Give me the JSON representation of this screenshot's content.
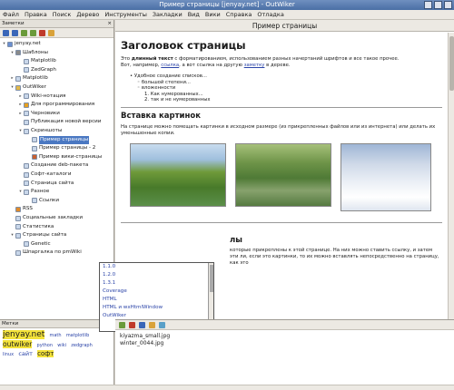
{
  "window": {
    "title": "Пример страницы [jenyay.net] - OutWiker"
  },
  "menu": [
    "Файл",
    "Правка",
    "Поиск",
    "Дерево",
    "Инструменты",
    "Закладки",
    "Вид",
    "Вики",
    "Справка",
    "Отладка"
  ],
  "left_pane": {
    "title": "Заметки",
    "tree": [
      {
        "label": "jenyay.net",
        "level": 0,
        "toggle": "▾",
        "icon": "book"
      },
      {
        "label": "Шаблоны",
        "level": 1,
        "toggle": "▾",
        "icon": "gear"
      },
      {
        "label": "Matplotlib",
        "level": 2,
        "toggle": "",
        "icon": "page"
      },
      {
        "label": "ZedGraph",
        "level": 2,
        "toggle": "",
        "icon": "page"
      },
      {
        "label": "Matplotlib",
        "level": 1,
        "toggle": "▸",
        "icon": "page"
      },
      {
        "label": "OutWiker",
        "level": 1,
        "toggle": "▾",
        "icon": "folder"
      },
      {
        "label": "Wiki-нотация",
        "level": 2,
        "toggle": "▸",
        "icon": "page"
      },
      {
        "label": "Для программирования",
        "level": 2,
        "toggle": "▸",
        "icon": "star"
      },
      {
        "label": "Черновики",
        "level": 2,
        "toggle": "▸",
        "icon": "page"
      },
      {
        "label": "Публикация новой версии",
        "level": 2,
        "toggle": "",
        "icon": "page"
      },
      {
        "label": "Скриншоты",
        "level": 2,
        "toggle": "▾",
        "icon": "page"
      },
      {
        "label": "Пример страницы",
        "level": 3,
        "toggle": "",
        "icon": "page",
        "selected": true
      },
      {
        "label": "Пример страницы - 2",
        "level": 3,
        "toggle": "",
        "icon": "page"
      },
      {
        "label": "Пример вики-страницы",
        "level": 3,
        "toggle": "",
        "icon": "brush"
      },
      {
        "label": "Создание deb-пакета",
        "level": 2,
        "toggle": "",
        "icon": "page"
      },
      {
        "label": "Софт-каталоги",
        "level": 2,
        "toggle": "",
        "icon": "page"
      },
      {
        "label": "Страница сайта",
        "level": 2,
        "toggle": "",
        "icon": "page"
      },
      {
        "label": "Разное",
        "level": 2,
        "toggle": "▾",
        "icon": "page"
      },
      {
        "label": "Ссылки",
        "level": 3,
        "toggle": "",
        "icon": "page"
      },
      {
        "label": "RSS",
        "level": 1,
        "toggle": "",
        "icon": "rss"
      },
      {
        "label": "Социальные закладки",
        "level": 1,
        "toggle": "",
        "icon": "page"
      },
      {
        "label": "Статистика",
        "level": 1,
        "toggle": "",
        "icon": "page"
      },
      {
        "label": "Страницы сайта",
        "level": 1,
        "toggle": "▾",
        "icon": "page"
      },
      {
        "label": "Genetic",
        "level": 2,
        "toggle": "",
        "icon": "page"
      },
      {
        "label": "Шпаргалка по pmWiki",
        "level": 1,
        "toggle": "",
        "icon": "page"
      }
    ]
  },
  "tags_pane": {
    "title": "Метки",
    "tags": [
      "jenyay.net",
      "math",
      "matplotlib",
      "outwiker",
      "python",
      "wiki",
      "zedgraph",
      "linux",
      "сайт",
      "софт"
    ]
  },
  "page": {
    "header": "Пример страницы",
    "title": "Заголовок страницы",
    "intro_1": "Это ",
    "intro_bold": "длинный текст",
    "intro_2": " с форматированием, использованием разных начертаний шрифтов и все такое прочее.",
    "intro_3": "Вот, например, ",
    "intro_link": "ссылка",
    "intro_4": ", а вот ссылка на другую ",
    "intro_link2": "заметку",
    "intro_5": " в дереве.",
    "list": [
      "Удобное создание списков...",
      "большой степени...",
      "вложенности",
      "1. Как нумерованных...",
      "2. так и не нумерованных"
    ],
    "section_title": "Вставка картинок",
    "section_text": "На странице можно помещать картинки в исходном размере (из прикрепленных файлов или из интернета) или делать их уменьшенные копии.",
    "section2_title_tail": "лы",
    "section2_text": "которые прикреплены к этой странице. На них можно ставить ссылку, и затем эти ли, если это картинки, то их можно вставлять непосредственно на страницу, как это"
  },
  "autocomplete": [
    "1.1.0",
    "1.2.0",
    "1.3.1",
    "Coverage",
    "HTML",
    "HTML и wxHtmlWindow",
    "OutWiker"
  ],
  "attachments": [
    "kiyazma_small.jpg",
    "winter_0044.jpg"
  ]
}
